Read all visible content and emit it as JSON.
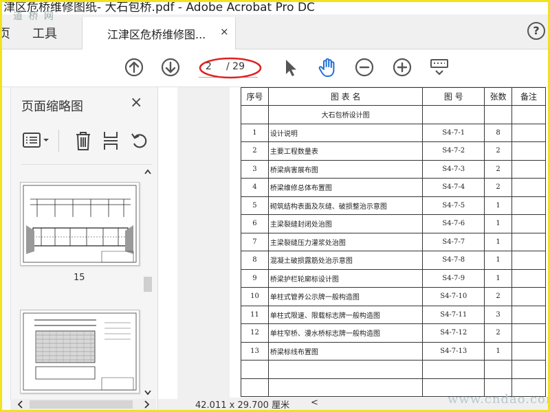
{
  "window": {
    "title": "津区危桥维修图纸- 大石包桥.pdf - Adobe Acrobat Pro DC"
  },
  "watermarks": {
    "top_left": "道 桥 网",
    "bottom_right": "www.cndao.com"
  },
  "tabs": {
    "partial": "页",
    "tools": "工具",
    "doc": "江津区危桥维修图...",
    "doc_close": "×"
  },
  "help": {
    "label": "?"
  },
  "nav": {
    "current_page": "2",
    "total": "/ 29"
  },
  "sidebar": {
    "title": "页面缩略图",
    "close": "×",
    "thumb_page": "15"
  },
  "status": {
    "page_size": "42.011 x 29.700 厘米",
    "scroll_left": "<"
  },
  "colors": {
    "accent_blue": "#1f6fd8",
    "annotation_red": "#e02020"
  },
  "table": {
    "headers": [
      "序号",
      "图 表 名",
      "图 号",
      "张数",
      "备注"
    ],
    "section": "大石包桥设计图",
    "rows": [
      {
        "no": "1",
        "name": "设计说明",
        "code": "S4-7-1",
        "count": "8"
      },
      {
        "no": "2",
        "name": "主要工程数量表",
        "code": "S4-7-2",
        "count": "2"
      },
      {
        "no": "3",
        "name": "桥梁病害展布图",
        "code": "S4-7-3",
        "count": "2"
      },
      {
        "no": "4",
        "name": "桥梁维修总体布置图",
        "code": "S4-7-4",
        "count": "2"
      },
      {
        "no": "5",
        "name": "砌筑结构表面及灰缝、破损整治示意图",
        "code": "S4-7-5",
        "count": "1"
      },
      {
        "no": "6",
        "name": "主梁裂缝封闭处治图",
        "code": "S4-7-6",
        "count": "1"
      },
      {
        "no": "7",
        "name": "主梁裂缝压力灌浆处治图",
        "code": "S4-7-7",
        "count": "1"
      },
      {
        "no": "8",
        "name": "混凝土破损露筋处治示意图",
        "code": "S4-7-8",
        "count": "1"
      },
      {
        "no": "9",
        "name": "桥梁护栏轮廓标设计图",
        "code": "S4-7-9",
        "count": "1"
      },
      {
        "no": "10",
        "name": "单柱式管养公示牌一般构造图",
        "code": "S4-7-10",
        "count": "2"
      },
      {
        "no": "11",
        "name": "单柱式限速、限载标志牌一般构造图",
        "code": "S4-7-11",
        "count": "3"
      },
      {
        "no": "12",
        "name": "单柱窄桥、漫水桥标志牌一般构造图",
        "code": "S4-7-12",
        "count": "2"
      },
      {
        "no": "13",
        "name": "桥梁标线布置图",
        "code": "S4-7-13",
        "count": "1"
      }
    ]
  }
}
